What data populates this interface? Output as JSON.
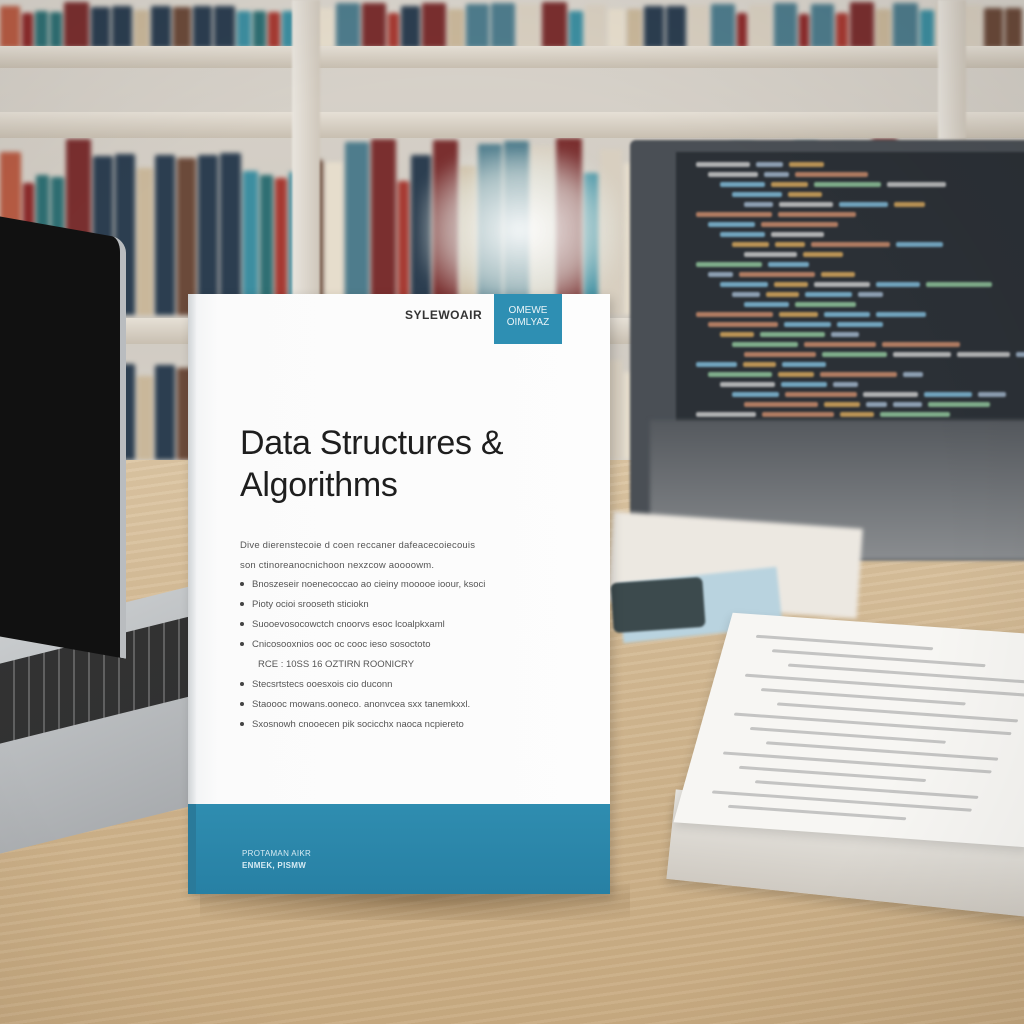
{
  "book": {
    "publisher": "SYLEWOAIR",
    "badge": "OMEWE\nOIMLYAZ",
    "title_line1": "Data Structures &",
    "title_line2": "Algorithms",
    "description": [
      "Dive dierenstecoie d coen reccaner dafeacecoiecouis",
      "son ctinoreanocnichoon nexzcow aoooowm."
    ],
    "bullets": [
      "Bnoszeseir noenecoccao ao cieiny mooooe ioour, ksoci",
      "Pioty ocioi srooseth sticiokn",
      "Suooevosocowctch cnoorvs esoc lcoalpkxaml",
      "Cnicosooxnios ooc oc cooc ieso sosoctoto",
      "RCE : 10SS 16 OZTIRN ROONICRY",
      "Stecsrtstecs ooesxois cio duconn",
      "Staoooc mowans.ooneco. anonvcea sxx tanemkxxl.",
      "Sxosnowh cnooecen pik socicchx naoca ncpiereto"
    ],
    "author_line1": "PROTAMAN AIKR",
    "author_line2": "ENMEK, PISMW"
  },
  "colors": {
    "cover_accent": "#2e8fb3",
    "desk": "#d2b892",
    "code_bg": "#2b3036"
  }
}
